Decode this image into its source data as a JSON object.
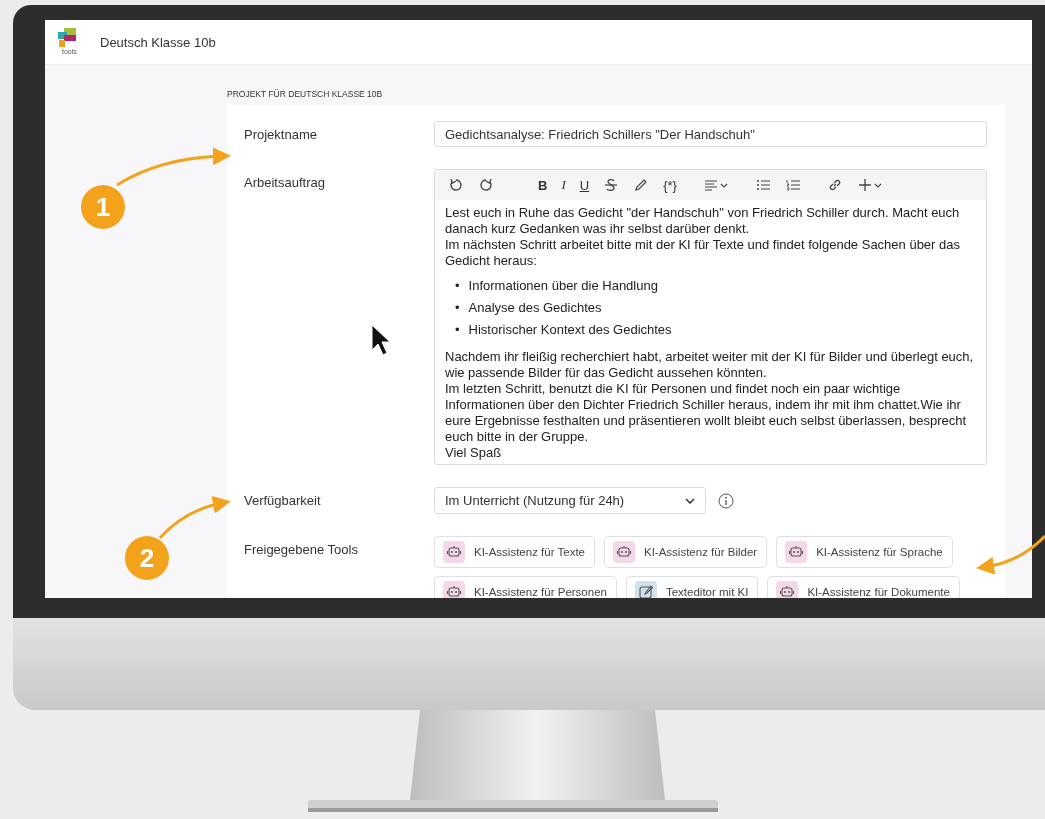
{
  "app": {
    "logo_text": "tools",
    "title": "Deutsch Klasse 10b"
  },
  "section_heading": "PROJEKT FÜR DEUTSCH KLASSE 10B",
  "form": {
    "project_name": {
      "label": "Projektname",
      "value": "Gedichtsanalyse: Friedrich Schillers \"Der Handschuh\""
    },
    "assignment": {
      "label": "Arbeitsauftrag",
      "toolbar": [
        {
          "kind": "undo"
        },
        {
          "kind": "redo"
        },
        {
          "kind": "bold",
          "label": "B"
        },
        {
          "kind": "italic",
          "label": "I"
        },
        {
          "kind": "underline",
          "label": "U"
        },
        {
          "kind": "strike"
        },
        {
          "kind": "pen"
        },
        {
          "kind": "variable",
          "label": "{*}"
        },
        {
          "kind": "align"
        },
        {
          "kind": "bullets"
        },
        {
          "kind": "numbers"
        },
        {
          "kind": "link"
        },
        {
          "kind": "insert"
        }
      ],
      "blocks": [
        {
          "kind": "paragraph",
          "text": "Lest euch in Ruhe das Gedicht \"der Handschuh\" von Friedrich Schiller durch. Macht euch danach kurz Gedanken was ihr selbst darüber denkt."
        },
        {
          "kind": "paragraph",
          "text": "Im nächsten Schritt arbeitet bitte mit der KI für Texte und findet folgende Sachen über das Gedicht heraus:"
        },
        {
          "kind": "list",
          "marker": "•",
          "items": [
            "Informationen über die Handlung",
            "Analyse des Gedichtes",
            "Historischer Kontext des Gedichtes"
          ]
        },
        {
          "kind": "paragraph",
          "text": "Nachdem ihr fleißig recherchiert habt, arbeitet weiter mit der KI für Bilder und überlegt euch, wie passende Bilder für das Gedicht aussehen könnten."
        },
        {
          "kind": "paragraph",
          "text": "Im letzten Schritt, benutzt die KI für Personen und findet noch ein paar wichtige Informationen über den Dichter Friedrich Schiller heraus, indem ihr mit ihm chattet.Wie ihr eure Ergebnisse festhalten und präsentieren wollt bleibt euch selbst überlassen, besprecht euch bitte in der Gruppe."
        },
        {
          "kind": "paragraph",
          "text": "Viel Spaß"
        }
      ]
    },
    "availability": {
      "label": "Verfügbarkeit",
      "value": "Im Unterricht (Nutzung für 24h)"
    },
    "tools": {
      "label": "Freigegebene Tools",
      "items": [
        {
          "kind": "assistant",
          "label": "KI-Assistenz für Texte"
        },
        {
          "kind": "assistant",
          "label": "KI-Assistenz für Bilder"
        },
        {
          "kind": "assistant",
          "label": "KI-Assistenz für Sprache"
        },
        {
          "kind": "assistant",
          "label": "KI-Assistenz für Personen"
        },
        {
          "kind": "editor",
          "label": "Texteditor mit KI"
        },
        {
          "kind": "assistant",
          "label": "KI-Assistenz für Dokumente"
        }
      ]
    }
  },
  "annotations": [
    {
      "label": "1"
    },
    {
      "label": "2"
    }
  ]
}
